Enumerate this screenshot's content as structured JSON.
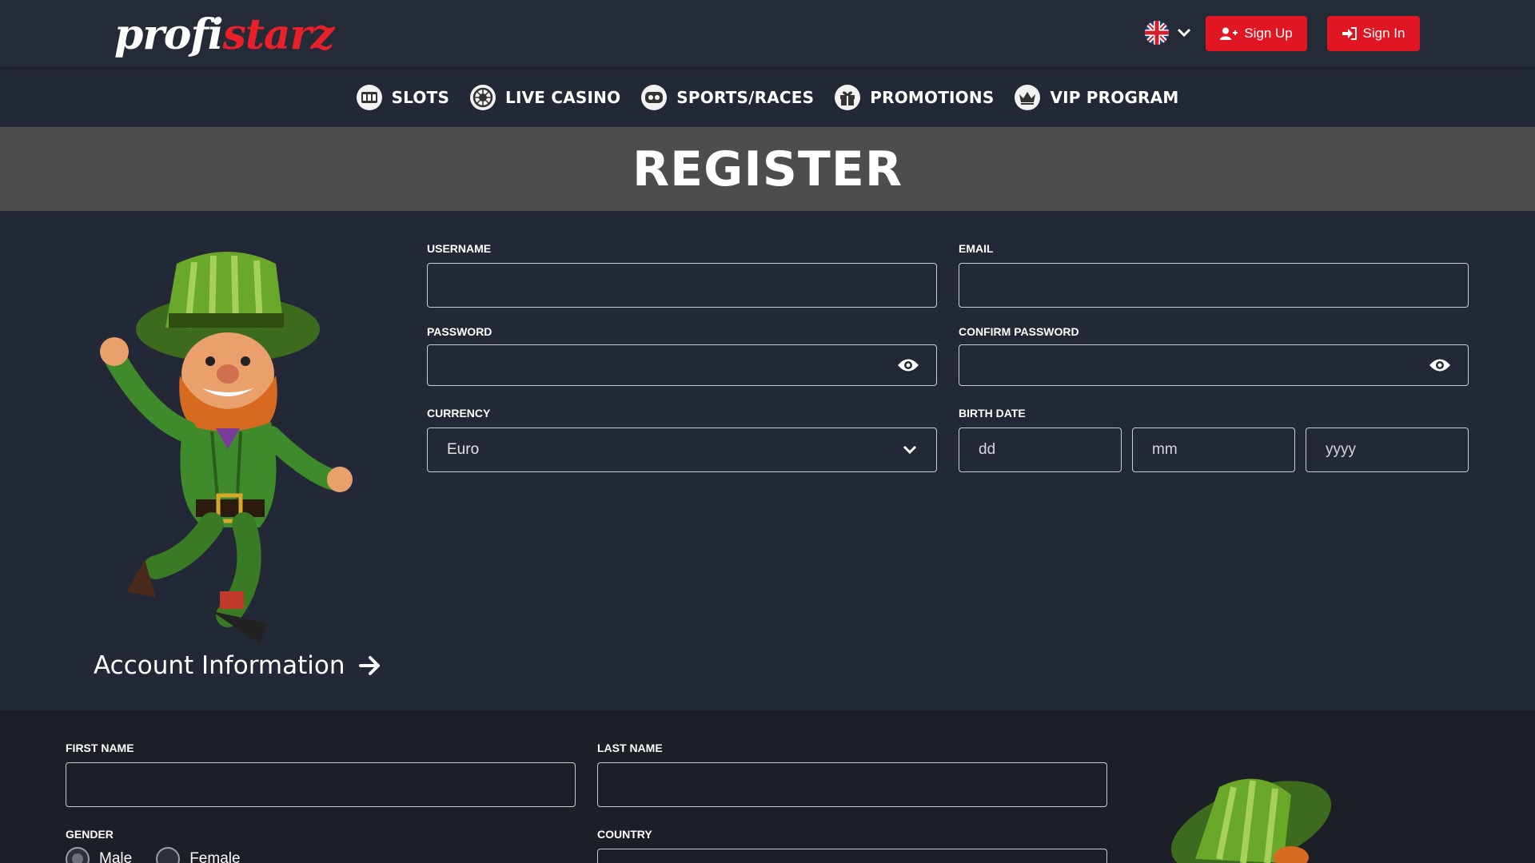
{
  "header": {
    "logo_part1": "profi",
    "logo_part2": "starz",
    "sign_up": "Sign Up",
    "sign_in": "Sign In"
  },
  "nav": {
    "items": [
      {
        "label": "SLOTS",
        "icon": "slot-machine-icon"
      },
      {
        "label": "LIVE CASINO",
        "icon": "roulette-icon"
      },
      {
        "label": "SPORTS/RACES",
        "icon": "controller-icon"
      },
      {
        "label": "PROMOTIONS",
        "icon": "gift-icon"
      },
      {
        "label": "VIP PROGRAM",
        "icon": "crown-icon"
      }
    ]
  },
  "page_title": "REGISTER",
  "account_form": {
    "username_label": "USERNAME",
    "username_value": "",
    "email_label": "EMAIL",
    "email_value": "",
    "password_label": "PASSWORD",
    "password_value": "",
    "confirm_password_label": "CONFIRM PASSWORD",
    "confirm_password_value": "",
    "currency_label": "CURRENCY",
    "currency_selected": "Euro",
    "birthdate_label": "BIRTH DATE",
    "birth_dd_placeholder": "dd",
    "birth_mm_placeholder": "mm",
    "birth_yyyy_placeholder": "yyyy"
  },
  "account_info_heading": "Account Information",
  "personal_form": {
    "first_name_label": "FIRST NAME",
    "last_name_label": "LAST NAME",
    "gender_label": "GENDER",
    "gender_male": "Male",
    "gender_female": "Female",
    "country_label": "COUNTRY"
  },
  "colors": {
    "brand_red": "#e01722",
    "background": "#232836",
    "banner_gray": "#4d4d4d"
  }
}
